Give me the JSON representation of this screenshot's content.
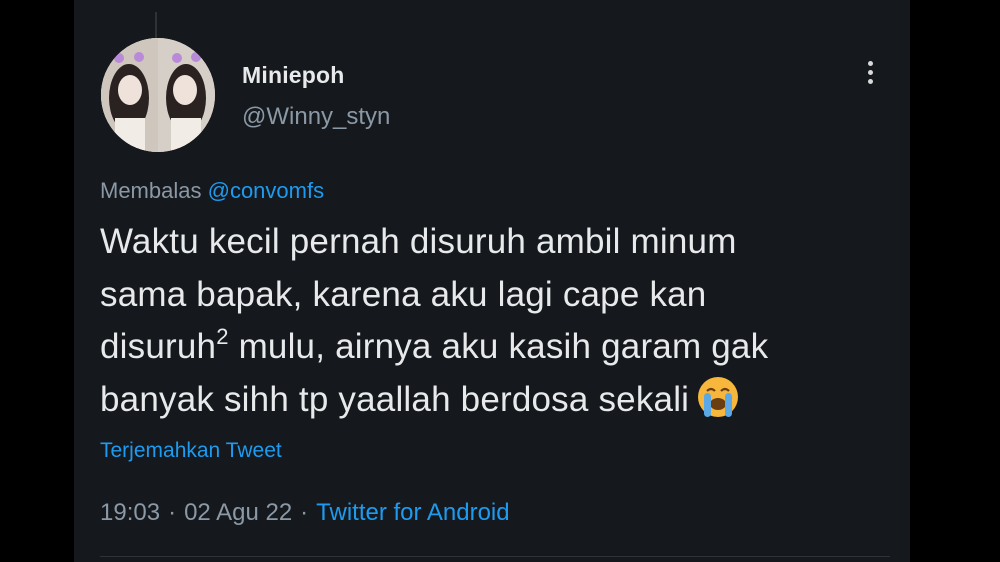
{
  "tweet": {
    "display_name": "Miniepoh",
    "handle": "@Winny_styn",
    "reply_prefix": "Membalas",
    "reply_to": "@convomfs",
    "text_lines": [
      "Waktu kecil pernah disuruh ambil minum",
      "sama bapak, karena aku lagi cape kan",
      "disuruh",
      "2",
      " mulu, airnya aku kasih garam gak",
      "banyak sihh tp yaallah berdosa sekali"
    ],
    "emoji": "loudly-crying-face",
    "translate_label": "Terjemahkan Tweet",
    "time": "19:03",
    "date": "02 Agu 22",
    "separator": "·",
    "source": "Twitter for Android"
  },
  "colors": {
    "background": "#15181c",
    "text": "#e7e9ea",
    "secondary": "#8b98a5",
    "accent": "#1d9bf0"
  }
}
